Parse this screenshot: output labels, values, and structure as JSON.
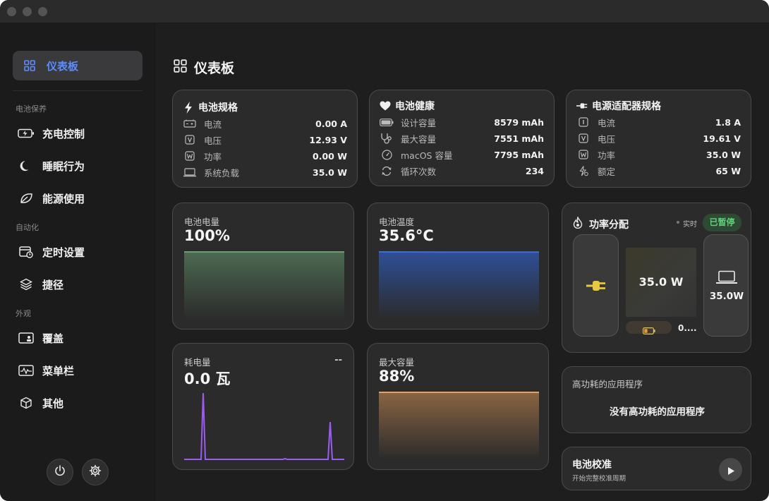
{
  "sidebar": {
    "active": {
      "label": "仪表板",
      "icon": "grid-icon"
    },
    "sections": [
      {
        "label": "电池保养"
      },
      {
        "label": "自动化"
      },
      {
        "label": "外观"
      }
    ],
    "items": [
      {
        "label": "充电控制",
        "icon": "battery-charging-icon"
      },
      {
        "label": "睡眠行为",
        "icon": "moon-icon"
      },
      {
        "label": "能源使用",
        "icon": "leaf-icon"
      },
      {
        "label": "定时设置",
        "icon": "calendar-clock-icon"
      },
      {
        "label": "捷径",
        "icon": "layers-icon"
      },
      {
        "label": "覆盖",
        "icon": "overlay-icon"
      },
      {
        "label": "菜单栏",
        "icon": "menubar-icon"
      },
      {
        "label": "其他",
        "icon": "cube-icon"
      }
    ],
    "footer": {
      "power_icon": "power-icon",
      "settings_icon": "gear-icon"
    }
  },
  "main": {
    "title": "仪表板",
    "title_icon": "grid-icon"
  },
  "battery_spec": {
    "title": "电池规格",
    "rows": [
      {
        "label": "电流",
        "value": "0.00 A"
      },
      {
        "label": "电压",
        "value": "12.93 V"
      },
      {
        "label": "功率",
        "value": "0.00 W"
      },
      {
        "label": "系统负载",
        "value": "35.0 W"
      }
    ]
  },
  "battery_health": {
    "title": "电池健康",
    "rows": [
      {
        "label": "设计容量",
        "value": "8579 mAh"
      },
      {
        "label": "最大容量",
        "value": "7551 mAh"
      },
      {
        "label": "macOS 容量",
        "value": "7795 mAh"
      },
      {
        "label": "循环次数",
        "value": "234"
      }
    ]
  },
  "adapter_spec": {
    "title": "电源适配器规格",
    "rows": [
      {
        "label": "电流",
        "value": "1.8 A"
      },
      {
        "label": "电压",
        "value": "19.61 V"
      },
      {
        "label": "功率",
        "value": "35.0 W"
      },
      {
        "label": "额定",
        "value": "65 W"
      }
    ]
  },
  "charge": {
    "label": "电池电量",
    "value": "100%",
    "level": 1.0,
    "color": "#6f9a74"
  },
  "temperature": {
    "label": "电池温度",
    "value": "35.6°C",
    "color": "#3f6fd6"
  },
  "consumption": {
    "label": "耗电量",
    "value": "0.0 瓦",
    "extra": "--",
    "color": "#9b5cf0"
  },
  "max_capacity": {
    "label": "最大容量",
    "value": "88%",
    "level": 0.88,
    "color": "#e4a066"
  },
  "power_flow": {
    "title": "功率分配",
    "live_label": "实时",
    "status": "已暂停",
    "center_value": "35.0 W",
    "laptop_value": "35.0W",
    "battery_value": "0....",
    "accent": "#e8c840",
    "status_color": "#5fd37a"
  },
  "high_power": {
    "title": "高功耗的应用程序",
    "empty_text": "没有高功耗的应用程序"
  },
  "calibration": {
    "title": "电池校准",
    "subtitle": "开始完整校准周期"
  }
}
